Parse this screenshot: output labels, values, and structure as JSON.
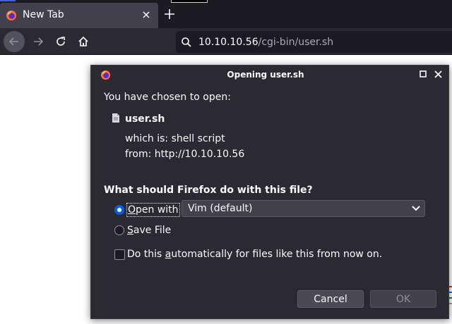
{
  "browser": {
    "tab": {
      "title": "New Tab",
      "icon": "firefox-icon"
    },
    "url": {
      "host": "10.10.10.56",
      "path": "/cgi-bin/user.sh"
    }
  },
  "dialog": {
    "title": "Opening user.sh",
    "chosen_text": "You have chosen to open:",
    "file_name": "user.sh",
    "which_is": "which is:  shell script",
    "from": "from:  http://10.10.10.56",
    "question": "What should Firefox do with this file?",
    "open_with": {
      "prefix": "O",
      "rest": "pen with",
      "selected": true
    },
    "app_select": {
      "value": "Vim (default)"
    },
    "save_file": {
      "prefix": "S",
      "rest": "ave File",
      "selected": false
    },
    "auto": {
      "before": "Do this ",
      "underlined": "a",
      "after": "utomatically for files like this from now on.",
      "checked": false
    },
    "buttons": {
      "cancel": "Cancel",
      "ok": "OK"
    }
  }
}
